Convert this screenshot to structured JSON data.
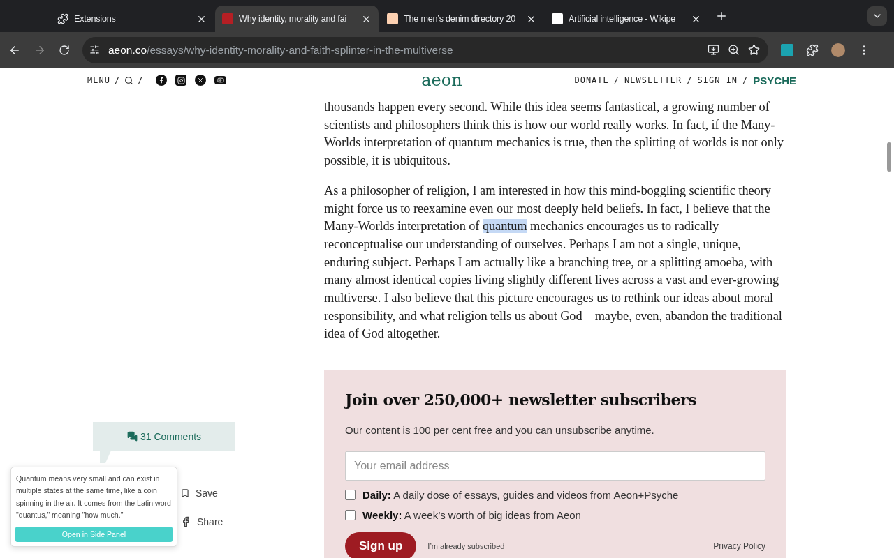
{
  "tabs": [
    {
      "title": "Extensions",
      "selected": false
    },
    {
      "title": "Why identity, morality and fai",
      "selected": true
    },
    {
      "title": "The men’s denim directory 20",
      "selected": false
    },
    {
      "title": "Artificial intelligence - Wikipe",
      "selected": false
    }
  ],
  "address_bar": {
    "url_host": "aeon.co",
    "url_path": "/essays/why-identity-morality-and-faith-splinter-in-the-multiverse"
  },
  "site_header": {
    "menu": "MENU",
    "separators": [
      "/",
      "/"
    ],
    "logo": "aeon",
    "right_links": [
      {
        "label": "DONATE",
        "kind": "link"
      },
      {
        "label": "/",
        "kind": "sep"
      },
      {
        "label": "NEWSLETTER",
        "kind": "link"
      },
      {
        "label": "/",
        "kind": "sep"
      },
      {
        "label": "SIGN IN",
        "kind": "link"
      },
      {
        "label": "/",
        "kind": "sep"
      },
      {
        "label": "PSYCHE",
        "kind": "brand"
      }
    ]
  },
  "article": {
    "paragraphs": [
      {
        "text_before": "thousands happen every second. While this idea seems fantastical, a growing number of scientists and philosophers think this is how our world really works. In fact, if the Many-Worlds interpretation of quantum mechanics is true, then the splitting of worlds is not only possible, it is ubiquitous."
      },
      {
        "text_before": "As a philosopher of religion, I am interested in how this mind-boggling scientific theory might force us to reexamine even our most deeply held beliefs. In fact, I believe that the Many-Worlds interpretation of ",
        "selected_word": "quantum",
        "text_after": " mechanics encourages us to radically reconceptualise our understanding of ourselves. Perhaps I am not a single, unique, enduring subject. Perhaps I am actually like a branching tree, or a splitting amoeba, with many almost identical copies living slightly different lives across a vast and ever-growing multiverse. I also believe that this picture encourages us to rethink our ideas about moral responsibility, and what religion tells us about God – maybe, even, abandon the traditional idea of God altogether."
      }
    ]
  },
  "newsletter": {
    "title": "Join over 250,000+ newsletter subscribers",
    "description": "Our content is 100 per cent free and you can unsubscribe anytime.",
    "email": {
      "placeholder": "Your email address"
    },
    "options": [
      {
        "label": "Daily:",
        "text": "A daily dose of essays, guides and videos from Aeon+Psyche",
        "checked": false
      },
      {
        "label": "Weekly:",
        "text": "A week’s worth of big ideas from Aeon",
        "checked": false
      }
    ],
    "submit": "Sign up",
    "already": "I’m already subscribed",
    "privacy": "Privacy Policy"
  },
  "sidebar": {
    "comments": "31 Comments",
    "actions": [
      {
        "label": "Save",
        "kind": "save"
      },
      {
        "label": "Share",
        "kind": "share"
      }
    ]
  },
  "definition_popup": {
    "text": "Quantum means very small and can exist in multiple states at the same time, like a coin spinning in the air. It comes from the Latin word \"quantus,\" meaning \"how much.\"",
    "button": "Open in Side Panel"
  }
}
